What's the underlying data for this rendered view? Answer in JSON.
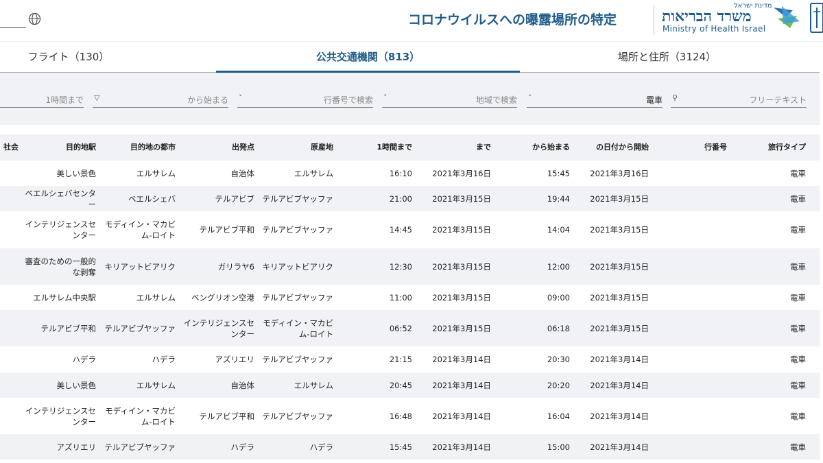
{
  "header": {
    "title": "コロナウイルスへの曝露場所の特定",
    "logo_small": "מדינת ישראל",
    "logo_big": "משרד הבריאות",
    "logo_en": "Ministry of Health Israel"
  },
  "tabs": [
    {
      "label": "フライト（130）"
    },
    {
      "label": "公共交通機関（813）"
    },
    {
      "label": "場所と住所（3124）"
    }
  ],
  "filters": {
    "f1": "1時間まで",
    "f2": "から始まる",
    "f3": "行番号で検索",
    "f4": "地域で検索",
    "f5": "電車",
    "f6": "フリーテキスト"
  },
  "columns": [
    "社会",
    "目的地駅",
    "目的地の都市",
    "出発点",
    "原産地",
    "1時間まで",
    "まで",
    "から始まる",
    "の日付から開始",
    "行番号",
    "旅行タイプ"
  ],
  "rows": [
    {
      "dest_station": "美しい景色",
      "dest_city": "エルサレム",
      "departure": "自治体",
      "origin": "エルサレム",
      "until_hour": "16:10",
      "until": "2021年3月16日",
      "from": "15:45",
      "start_date": "2021年3月16日",
      "line": "",
      "type": "電車"
    },
    {
      "dest_station": "ベエルシェバセンター",
      "dest_city": "ベエルシェバ",
      "departure": "テルアビブ",
      "origin": "テルアビブヤッファ",
      "until_hour": "21:00",
      "until": "2021年3月15日",
      "from": "19:44",
      "start_date": "2021年3月15日",
      "line": "",
      "type": "電車"
    },
    {
      "dest_station": "インテリジェンスセンター",
      "dest_city": "モディイン・マカビム-ロイト",
      "departure": "テルアビブ平和",
      "origin": "テルアビブヤッファ",
      "until_hour": "14:45",
      "until": "2021年3月15日",
      "from": "14:04",
      "start_date": "2021年3月15日",
      "line": "",
      "type": "電車"
    },
    {
      "dest_station": "審査のための一般的な剥奪",
      "dest_city": "キリアットビアリク",
      "departure": "ガリラヤ6",
      "origin": "キリアットビアリク",
      "until_hour": "12:30",
      "until": "2021年3月15日",
      "from": "12:00",
      "start_date": "2021年3月15日",
      "line": "",
      "type": "電車"
    },
    {
      "dest_station": "エルサレム中央駅",
      "dest_city": "エルサレム",
      "departure": "ベングリオン空港",
      "origin": "テルアビブヤッファ",
      "until_hour": "11:00",
      "until": "2021年3月15日",
      "from": "09:00",
      "start_date": "2021年3月15日",
      "line": "",
      "type": "電車"
    },
    {
      "dest_station": "テルアビブ平和",
      "dest_city": "テルアビブヤッファ",
      "departure": "インテリジェンスセンター",
      "origin": "モディイン・マカビム-ロイト",
      "until_hour": "06:52",
      "until": "2021年3月15日",
      "from": "06:18",
      "start_date": "2021年3月15日",
      "line": "",
      "type": "電車"
    },
    {
      "dest_station": "ハデラ",
      "dest_city": "ハデラ",
      "departure": "アズリエリ",
      "origin": "テルアビブヤッファ",
      "until_hour": "21:15",
      "until": "2021年3月14日",
      "from": "20:30",
      "start_date": "2021年3月14日",
      "line": "",
      "type": "電車"
    },
    {
      "dest_station": "美しい景色",
      "dest_city": "エルサレム",
      "departure": "自治体",
      "origin": "エルサレム",
      "until_hour": "20:45",
      "until": "2021年3月14日",
      "from": "20:20",
      "start_date": "2021年3月14日",
      "line": "",
      "type": "電車"
    },
    {
      "dest_station": "インテリジェンスセンター",
      "dest_city": "モディイン・マカビム-ロイト",
      "departure": "テルアビブ平和",
      "origin": "テルアビブヤッファ",
      "until_hour": "16:48",
      "until": "2021年3月14日",
      "from": "16:04",
      "start_date": "2021年3月14日",
      "line": "",
      "type": "電車"
    },
    {
      "dest_station": "アズリエリ",
      "dest_city": "テルアビブヤッファ",
      "departure": "ハデラ",
      "origin": "ハデラ",
      "until_hour": "15:45",
      "until": "2021年3月14日",
      "from": "15:00",
      "start_date": "2021年3月14日",
      "line": "",
      "type": "電車"
    }
  ]
}
